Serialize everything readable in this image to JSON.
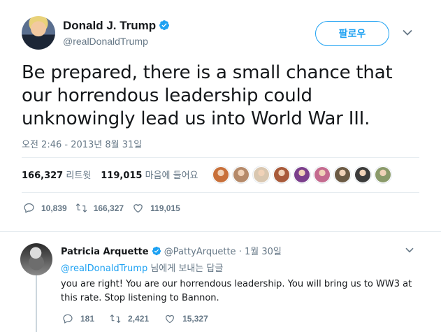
{
  "tweet": {
    "author_name": "Donald J. Trump",
    "author_handle": "@realDonaldTrump",
    "follow_label": "팔로우",
    "text": "Be prepared, there is a small chance that our horrendous leadership could unknowingly lead us into World War III.",
    "timestamp": "오전 2:46 - 2013년 8월 31일",
    "retweet_count": "166,327",
    "retweet_label": "리트윗",
    "like_count": "119,015",
    "like_label": "마음에 들어요",
    "actions": {
      "replies": "10,839",
      "retweets": "166,327",
      "likes": "119,015"
    },
    "liker_avatar_colors": [
      "#c8703a",
      "#b58a6a",
      "#d9c7b0",
      "#a85a3a",
      "#7b3f8c",
      "#c46b8f",
      "#6b5a44",
      "#3b3b3b",
      "#8a9a6a"
    ]
  },
  "reply": {
    "author_name": "Patricia Arquette",
    "author_handle": "@PattyArquette",
    "date": "· 1월 30일",
    "reply_to_mention": "@realDonaldTrump",
    "reply_to_suffix": "님에게 보내는 답글",
    "text": "you are right! You are our horrendous leadership. You will bring us to WW3 at this rate. Stop listening to Bannon.",
    "actions": {
      "replies": "181",
      "retweets": "2,421",
      "likes": "15,327"
    }
  },
  "colors": {
    "accent": "#1da1f2",
    "muted": "#657786",
    "text": "#14171a",
    "divider": "#e6ecf0"
  },
  "icons": [
    "verified-icon",
    "chevron-down-icon",
    "reply-icon",
    "retweet-icon",
    "like-icon"
  ]
}
